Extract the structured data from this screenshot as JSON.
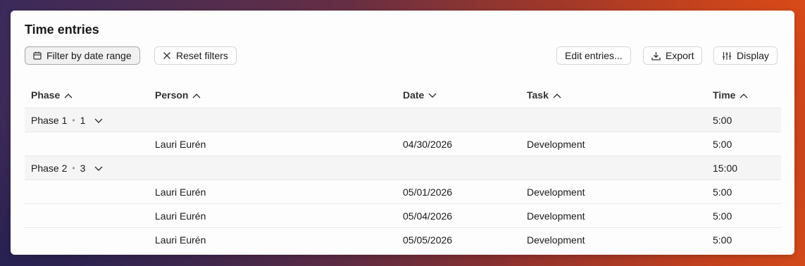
{
  "title": "Time entries",
  "toolbar": {
    "filter_label": "Filter by date range",
    "reset_label": "Reset filters",
    "edit_label": "Edit entries...",
    "export_label": "Export",
    "display_label": "Display"
  },
  "columns": {
    "phase": "Phase",
    "person": "Person",
    "date": "Date",
    "task": "Task",
    "time": "Time"
  },
  "groups": [
    {
      "name": "Phase 1",
      "count": "1",
      "total": "5:00",
      "rows": [
        {
          "person": "Lauri Eurén",
          "date": "04/30/2026",
          "task": "Development",
          "time": "5:00"
        }
      ]
    },
    {
      "name": "Phase 2",
      "count": "3",
      "total": "15:00",
      "rows": [
        {
          "person": "Lauri Eurén",
          "date": "05/01/2026",
          "task": "Development",
          "time": "5:00"
        },
        {
          "person": "Lauri Eurén",
          "date": "05/04/2026",
          "task": "Development",
          "time": "5:00"
        },
        {
          "person": "Lauri Eurén",
          "date": "05/05/2026",
          "task": "Development",
          "time": "5:00"
        }
      ]
    }
  ],
  "sort_icons": {
    "phase": "chevron-up-icon",
    "person": "chevron-up-icon",
    "date": "chevron-down-icon",
    "task": "chevron-up-icon",
    "time": "chevron-up-icon"
  }
}
